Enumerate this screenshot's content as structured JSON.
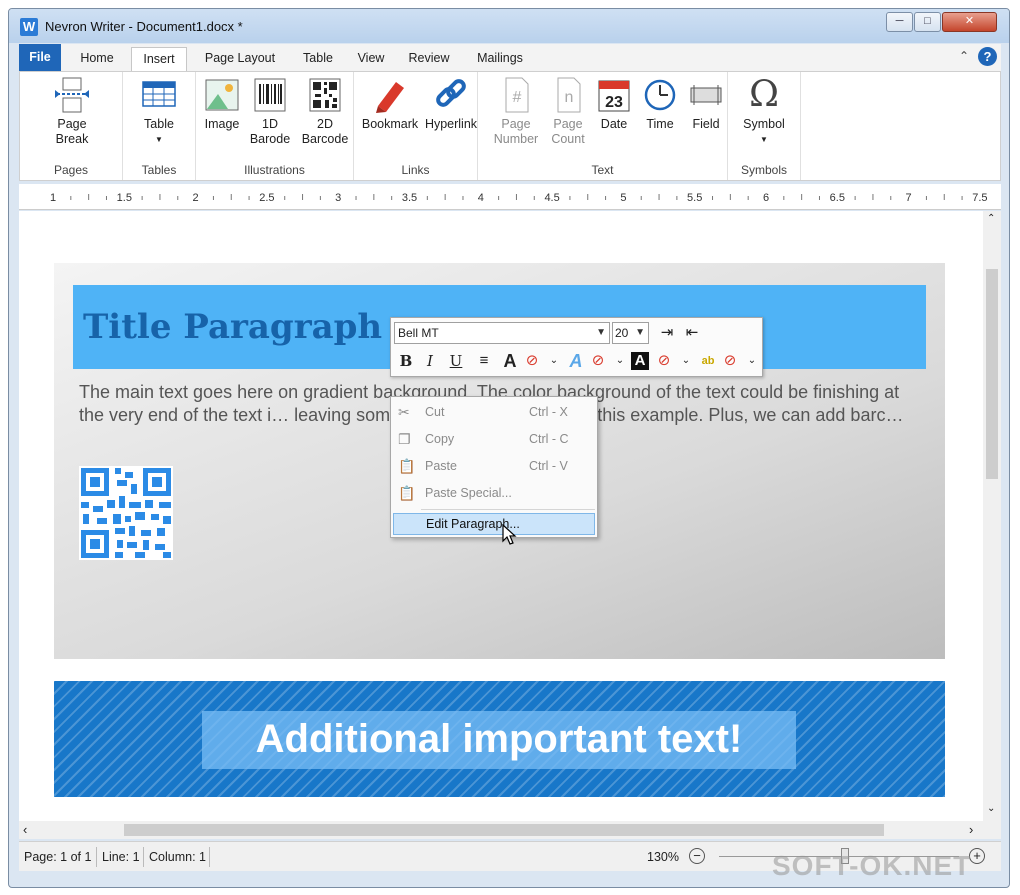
{
  "window": {
    "title": "Nevron Writer - Document1.docx *",
    "app_icon_letter": "W"
  },
  "tabs": [
    "File",
    "Home",
    "Insert",
    "Page Layout",
    "Table",
    "View",
    "Review",
    "Mailings"
  ],
  "ribbon": {
    "groups": [
      {
        "label": "Pages",
        "buttons": [
          {
            "label": "Page",
            "label2": "Break"
          }
        ]
      },
      {
        "label": "Tables",
        "buttons": [
          {
            "label": "Table"
          }
        ]
      },
      {
        "label": "Illustrations",
        "buttons": [
          {
            "label": "Image"
          },
          {
            "label": "1D",
            "label2": "Barode"
          },
          {
            "label": "2D",
            "label2": "Barcode"
          }
        ]
      },
      {
        "label": "Links",
        "buttons": [
          {
            "label": "Bookmark"
          },
          {
            "label": "Hyperlink"
          }
        ]
      },
      {
        "label": "Text",
        "buttons": [
          {
            "label": "Page",
            "label2": "Number"
          },
          {
            "label": "Page",
            "label2": "Count"
          },
          {
            "label": "Date"
          },
          {
            "label": "Time"
          },
          {
            "label": "Field"
          }
        ],
        "calendar_day": "23"
      },
      {
        "label": "Symbols",
        "buttons": [
          {
            "label": "Symbol"
          }
        ],
        "symbol_glyph": "Ω"
      }
    ]
  },
  "ruler": {
    "marks": [
      "1",
      "1.5",
      "2",
      "2.5",
      "3",
      "3.5",
      "4",
      "4.5",
      "5",
      "5.5",
      "6",
      "6.5",
      "7",
      "7.5"
    ]
  },
  "document": {
    "title_paragraph": "Title Paragraph",
    "body_text": "The main text goes here on gradient background. The color background of the text could be finishing at the very end of the text i… leaving some additional spacing as in this example. Plus, we can add barc…",
    "banner_text": "Additional important text!"
  },
  "mini_toolbar": {
    "font": "Bell MT",
    "size": "20"
  },
  "context_menu": {
    "items": [
      {
        "label": "Cut",
        "shortcut": "Ctrl - X"
      },
      {
        "label": "Copy",
        "shortcut": "Ctrl - C"
      },
      {
        "label": "Paste",
        "shortcut": "Ctrl - V"
      },
      {
        "label": "Paste Special..."
      }
    ],
    "highlighted": "Edit Paragraph..."
  },
  "status": {
    "page": "Page: 1 of 1",
    "line": "Line: 1",
    "column": "Column: 1",
    "zoom": "130%"
  },
  "watermark": "SOFT-OK.NET",
  "colors": {
    "accent": "#1f66b8",
    "title_band": "#4fb3f6",
    "title_text": "#1763a9",
    "banner": "#1877c9"
  }
}
